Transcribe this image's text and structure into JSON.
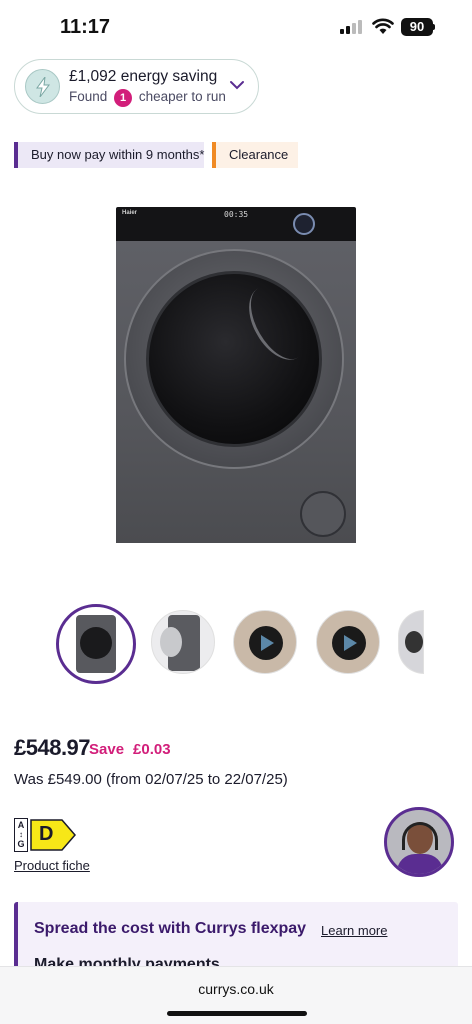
{
  "status_bar": {
    "time": "11:17",
    "battery": "90",
    "icons": [
      "cellular-signal-icon",
      "wifi-icon",
      "battery-icon"
    ]
  },
  "energy_saving": {
    "title": "£1,092 energy saving",
    "found_label": "Found",
    "count": "1",
    "suffix": "cheaper to run",
    "icon": "lightning-bolt-icon",
    "accent": "#d21e7a"
  },
  "tags": {
    "bnpl": "Buy now pay within 9 months*",
    "clearance": "Clearance",
    "bnpl_color": "#5a2d91",
    "clearance_color": "#f08a24"
  },
  "product_image": {
    "brand": "Haier",
    "display": "00:35"
  },
  "gallery": {
    "thumbnails": [
      "washer-front",
      "washer-open-door",
      "video",
      "video",
      "detail"
    ],
    "selected_index": 0
  },
  "pricing": {
    "price": "£548.97",
    "save_label": "Save",
    "save_amount": "£0.03",
    "was": "Was £549.00 (from 02/07/25 to 22/07/25)"
  },
  "energy_rating": {
    "scale": [
      "A",
      "G"
    ],
    "rating": "D",
    "fiche_link": "Product fiche",
    "rating_color": "#f7e717"
  },
  "flexpay": {
    "title": "Spread the cost with Currys flexpay",
    "learn_more": "Learn more",
    "subtitle": "Make monthly payments"
  },
  "browser": {
    "url": "currys.co.uk"
  },
  "colors": {
    "brand_purple": "#5a2d91",
    "sale_pink": "#d21e7a"
  }
}
